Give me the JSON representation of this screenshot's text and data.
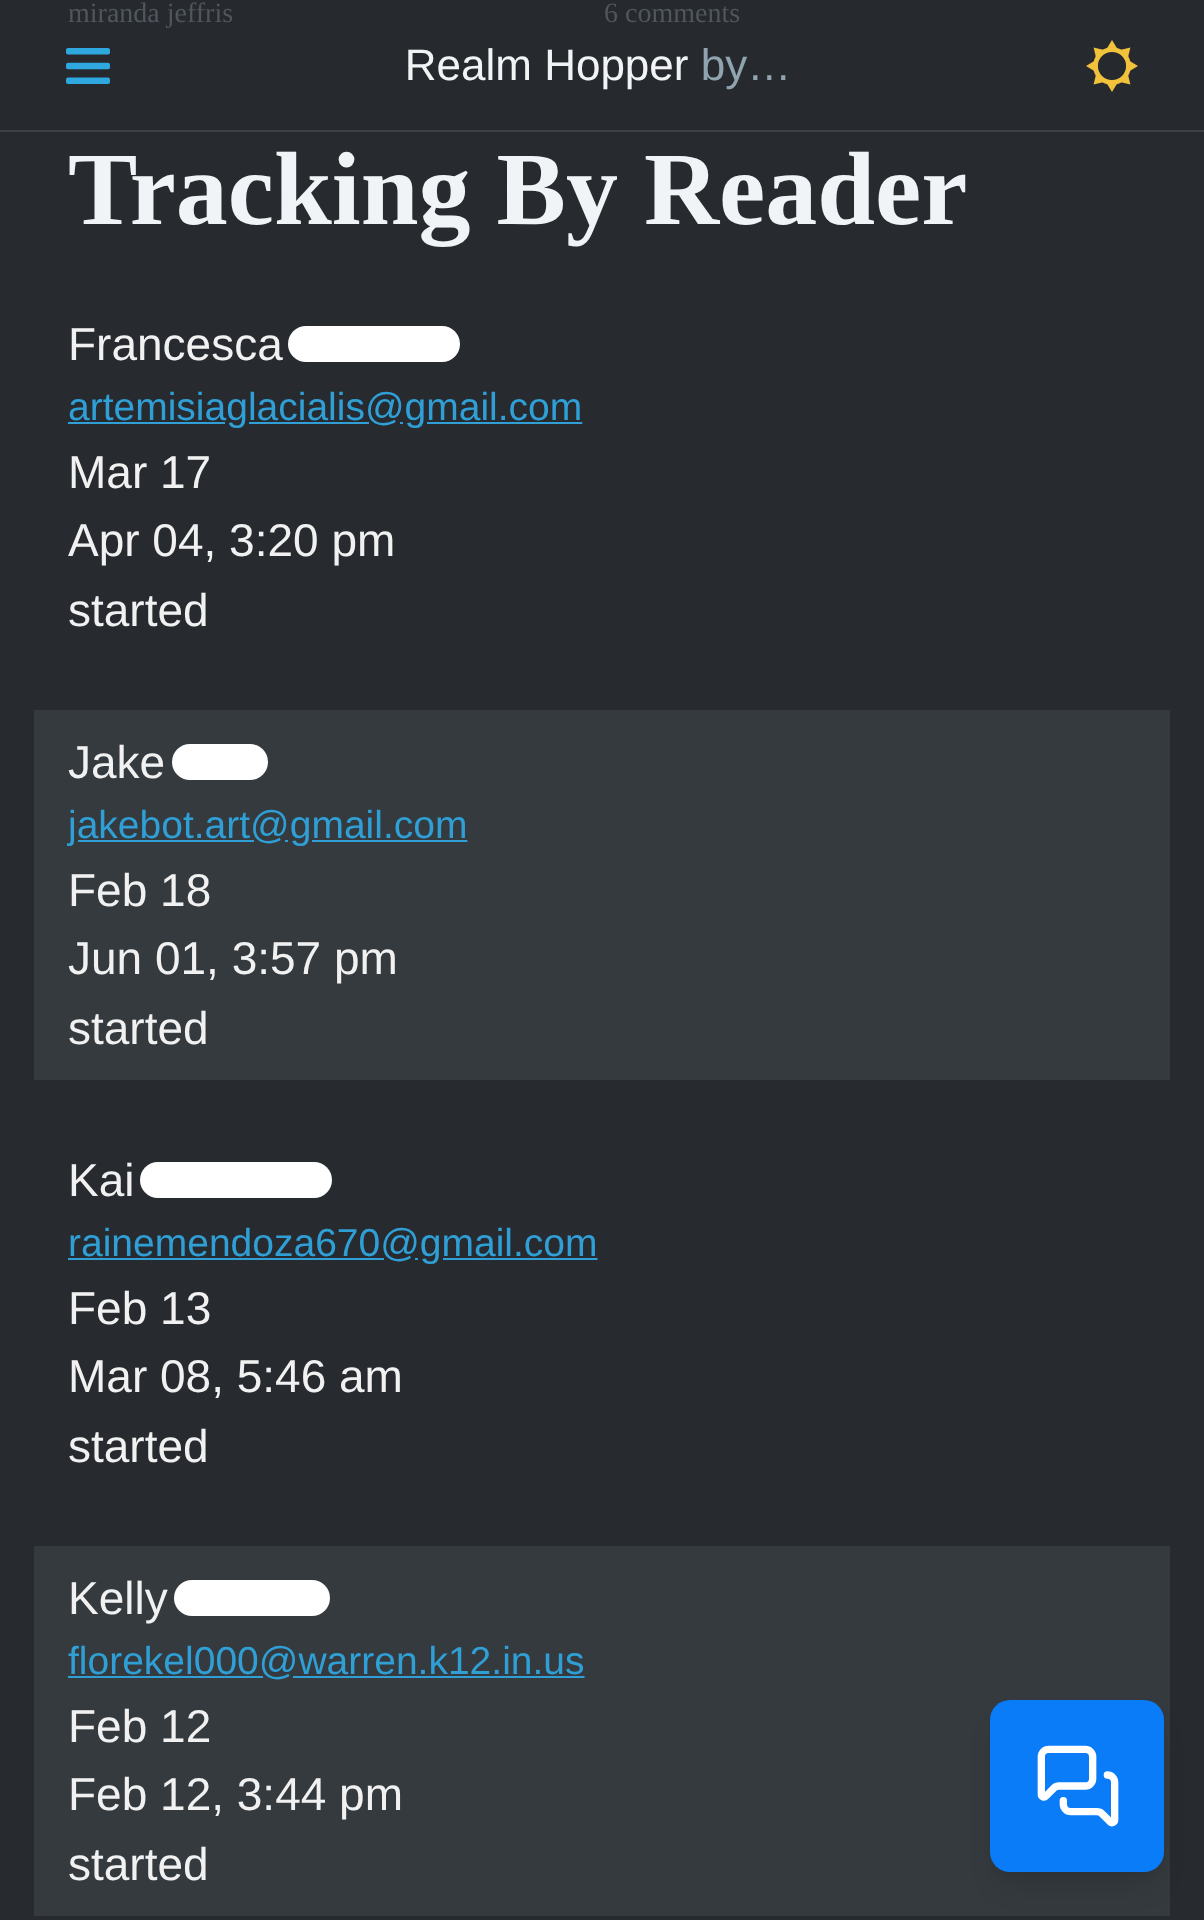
{
  "behind_header": {
    "author": "miranda jeffris",
    "comments": "6 comments"
  },
  "header": {
    "title": "Realm Hopper",
    "title_suffix": "by…"
  },
  "page_title": "Tracking By Reader",
  "readers": [
    {
      "name": "Francesca",
      "email": "artemisiaglacialis@gmail.com",
      "date": "Mar 17",
      "last_activity": "Apr 04, 3:20 pm",
      "status": "started"
    },
    {
      "name": "Jake",
      "email": "jakebot.art@gmail.com",
      "date": "Feb 18",
      "last_activity": "Jun 01, 3:57 pm",
      "status": "started"
    },
    {
      "name": "Kai",
      "email": "rainemendoza670@gmail.com",
      "date": "Feb 13",
      "last_activity": "Mar 08, 5:46 am",
      "status": "started"
    },
    {
      "name": "Kelly",
      "email": "florekel000@warren.k12.in.us",
      "date": "Feb 12",
      "last_activity": "Feb 12, 3:44 pm",
      "status": "started"
    }
  ]
}
